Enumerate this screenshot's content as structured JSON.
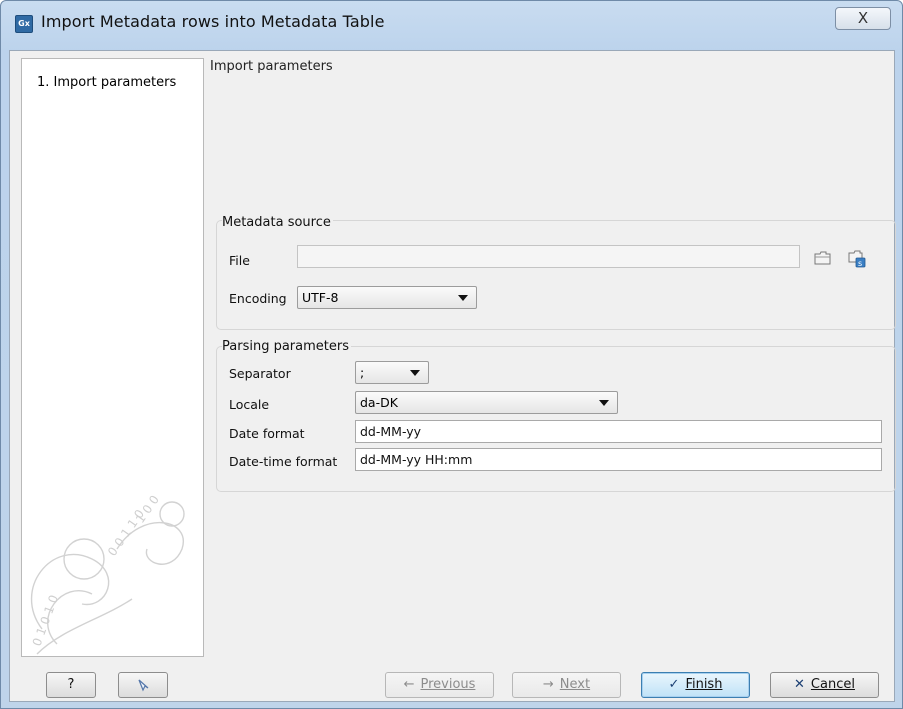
{
  "window": {
    "title": "Import Metadata rows into Metadata Table",
    "app_icon_text": "Gx",
    "close_symbol": "X"
  },
  "steps": [
    {
      "label": "1.  Import parameters"
    }
  ],
  "page_header": "Import parameters",
  "metadata_source": {
    "legend": "Metadata source",
    "file_label": "File",
    "file_value": "",
    "encoding_label": "Encoding",
    "encoding_value": "UTF-8"
  },
  "parsing": {
    "legend": "Parsing parameters",
    "separator_label": "Separator",
    "separator_value": ";",
    "locale_label": "Locale",
    "locale_value": "da-DK",
    "date_format_label": "Date format",
    "date_format_value": "dd-MM-yy",
    "datetime_format_label": "Date-time format",
    "datetime_format_value": "dd-MM-yy HH:mm"
  },
  "footer": {
    "help_label": "?",
    "previous_label": "Previous",
    "next_label": "Next",
    "finish_label": "Finish",
    "cancel_label": "Cancel"
  },
  "icons": {
    "folder": "folder-icon",
    "server_folder": "server-folder-icon",
    "reset": "reset-icon",
    "check": "checkmark-icon",
    "cross": "cross-icon"
  },
  "colors": {
    "title_bar": "#bcd3ec",
    "dialog_bg": "#f0f0f0",
    "finish_accent": "#3c7fb1"
  }
}
